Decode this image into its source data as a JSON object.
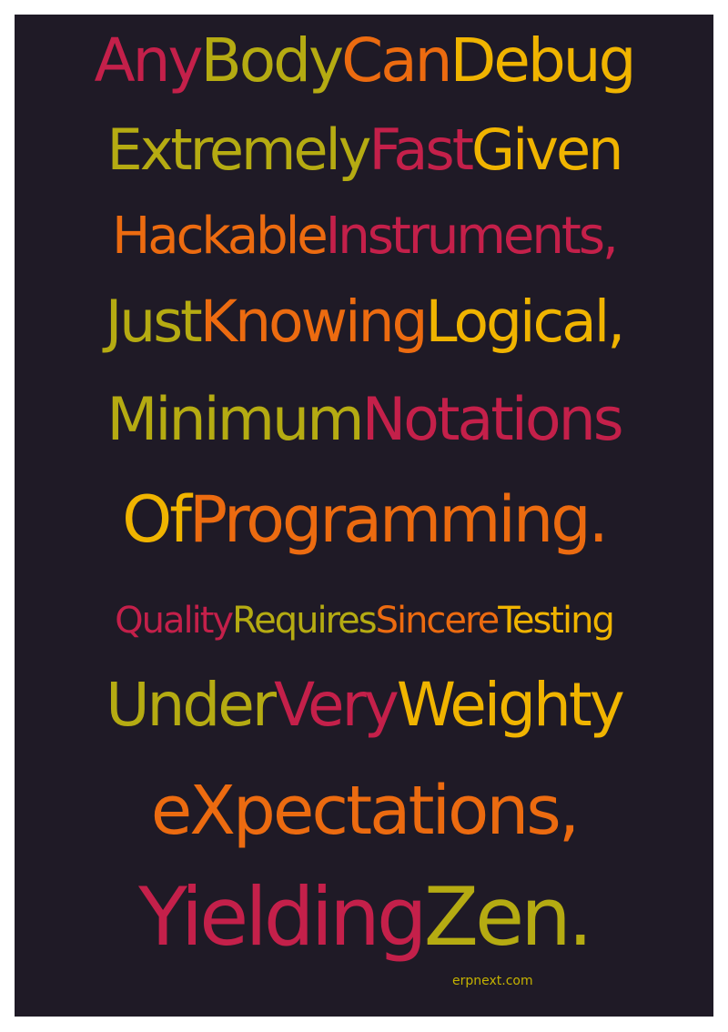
{
  "poster": {
    "background": "#1f1a26",
    "palette": {
      "crimson": "#c4204a",
      "olive": "#b5ab12",
      "orange": "#ec6b10",
      "gold": "#f0b400"
    },
    "lines": [
      {
        "words": [
          {
            "text": "Any",
            "color": "crimson"
          },
          {
            "text": "Body",
            "color": "olive"
          },
          {
            "text": "Can",
            "color": "orange"
          },
          {
            "text": "Debug",
            "color": "gold"
          }
        ]
      },
      {
        "words": [
          {
            "text": "Extremely",
            "color": "olive"
          },
          {
            "text": "Fast",
            "color": "crimson"
          },
          {
            "text": "Given",
            "color": "gold"
          }
        ]
      },
      {
        "words": [
          {
            "text": "Hackable",
            "color": "orange"
          },
          {
            "text": "Instruments,",
            "color": "crimson"
          }
        ]
      },
      {
        "words": [
          {
            "text": "Just",
            "color": "olive"
          },
          {
            "text": "Knowing",
            "color": "orange"
          },
          {
            "text": "Logical,",
            "color": "gold"
          }
        ]
      },
      {
        "words": [
          {
            "text": "Minimum",
            "color": "olive"
          },
          {
            "text": "Notations",
            "color": "crimson"
          }
        ]
      },
      {
        "words": [
          {
            "text": "Of",
            "color": "gold"
          },
          {
            "text": "Programming.",
            "color": "orange"
          }
        ]
      },
      {
        "words": [
          {
            "text": "Quality",
            "color": "crimson"
          },
          {
            "text": "Requires",
            "color": "olive"
          },
          {
            "text": "Sincere",
            "color": "orange"
          },
          {
            "text": "Testing",
            "color": "gold"
          }
        ]
      },
      {
        "words": [
          {
            "text": "Under",
            "color": "olive"
          },
          {
            "text": "Very",
            "color": "crimson"
          },
          {
            "text": "Weighty",
            "color": "gold"
          }
        ]
      },
      {
        "words": [
          {
            "text": "eXpectations,",
            "color": "orange"
          }
        ]
      },
      {
        "words": [
          {
            "text": "Yielding",
            "color": "crimson"
          },
          {
            "text": "Zen.",
            "color": "olive"
          }
        ]
      }
    ],
    "credit": "erpnext.com"
  }
}
